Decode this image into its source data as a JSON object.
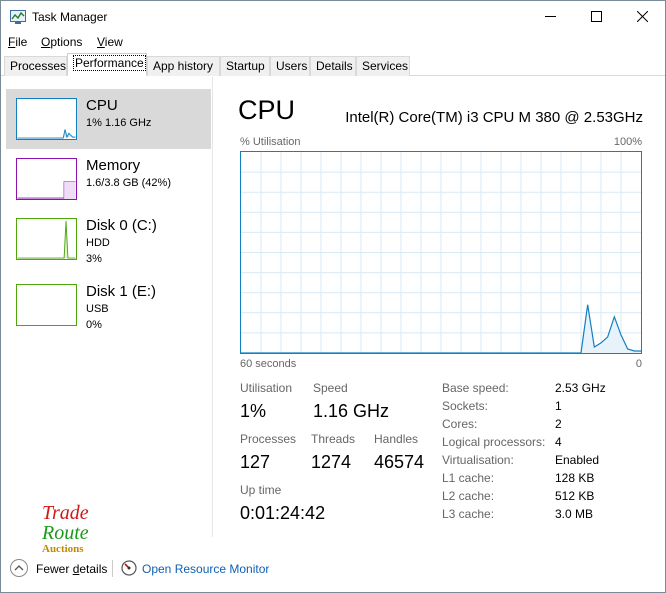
{
  "window": {
    "title": "Task Manager"
  },
  "menu": [
    {
      "label": "File",
      "ul": "F",
      "rest": "ile"
    },
    {
      "label": "Options",
      "ul": "O",
      "rest": "ptions"
    },
    {
      "label": "View",
      "ul": "V",
      "rest": "iew"
    }
  ],
  "tabs": [
    {
      "label": "Processes"
    },
    {
      "label": "Performance",
      "active": true
    },
    {
      "label": "App history"
    },
    {
      "label": "Startup"
    },
    {
      "label": "Users"
    },
    {
      "label": "Details"
    },
    {
      "label": "Services"
    }
  ],
  "sidebar": {
    "cpu": {
      "title": "CPU",
      "sub": "1%  1.16 GHz",
      "color": "#1180c0"
    },
    "memory": {
      "title": "Memory",
      "sub": "1.6/3.8 GB (42%)",
      "color": "#8b12ae"
    },
    "disk0": {
      "title": "Disk 0 (C:)",
      "sub1": "HDD",
      "sub2": "3%",
      "color": "#4da60c"
    },
    "disk1": {
      "title": "Disk 1 (E:)",
      "sub1": "USB",
      "sub2": "0%",
      "color": "#4da60c"
    }
  },
  "main": {
    "title": "CPU",
    "cpu_name": "Intel(R) Core(TM) i3 CPU M 380 @ 2.53GHz",
    "util_label": "% Utilisation",
    "max_label": "100%",
    "time_label": "60 seconds",
    "min_label": "0",
    "stats": {
      "utilisation_label": "Utilisation",
      "utilisation": "1%",
      "speed_label": "Speed",
      "speed": "1.16 GHz",
      "processes_label": "Processes",
      "processes": "127",
      "threads_label": "Threads",
      "threads": "1274",
      "handles_label": "Handles",
      "handles": "46574",
      "uptime_label": "Up time",
      "uptime": "0:01:24:42"
    },
    "specs": [
      {
        "label": "Base speed:",
        "value": "2.53 GHz"
      },
      {
        "label": "Sockets:",
        "value": "1"
      },
      {
        "label": "Cores:",
        "value": "2"
      },
      {
        "label": "Logical processors:",
        "value": "4"
      },
      {
        "label": "Virtualisation:",
        "value": "Enabled"
      },
      {
        "label": "L1 cache:",
        "value": "128 KB"
      },
      {
        "label": "L2 cache:",
        "value": "512 KB"
      },
      {
        "label": "L3 cache:",
        "value": "3.0 MB"
      }
    ]
  },
  "footer": {
    "fewer_ul": "d",
    "fewer_a": "Fewer ",
    "fewer_b": "etails",
    "resource_monitor": "Open Resource Monitor"
  },
  "logo": {
    "line1": "Trade",
    "line2": "Route",
    "line3": "Auctions"
  },
  "cpu_graph": {
    "type": "line",
    "ylim": [
      0,
      100
    ],
    "values": [
      0,
      0,
      0,
      0,
      0,
      0,
      0,
      0,
      0,
      0,
      0,
      0,
      0,
      0,
      0,
      0,
      0,
      0,
      0,
      0,
      0,
      0,
      0,
      0,
      0,
      0,
      0,
      0,
      0,
      0,
      0,
      0,
      0,
      0,
      0,
      0,
      0,
      0,
      0,
      0,
      0,
      0,
      0,
      0,
      0,
      0,
      0,
      0,
      0,
      0,
      0,
      0,
      24,
      3,
      5,
      8,
      18,
      9,
      2,
      1,
      1
    ]
  },
  "colors": {
    "cpu": "#1180c0",
    "memory": "#8b12ae",
    "disk": "#4da60c",
    "link": "#1060b0"
  }
}
